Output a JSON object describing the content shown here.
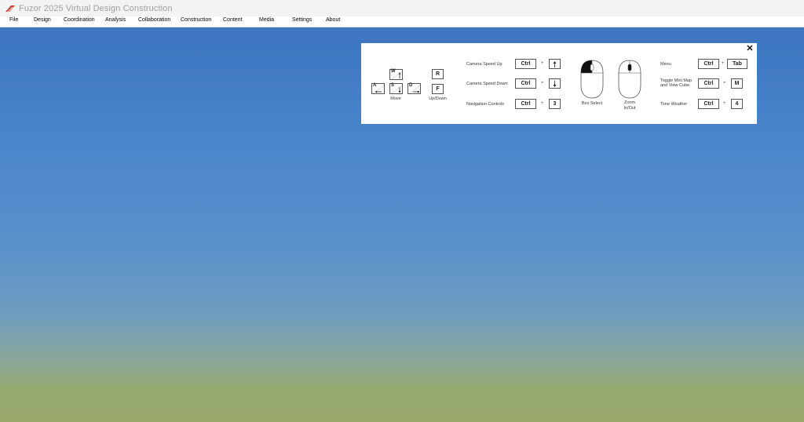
{
  "window": {
    "title": "Fuzor 2025 Virtual Design Construction",
    "logo_icon": "fuzor-logo-icon"
  },
  "menu": {
    "items": [
      "File",
      "Design",
      "Coordination",
      "Analysis",
      "Collaboration",
      "Construction",
      "Content",
      "Media",
      "Settings",
      "About"
    ]
  },
  "controls_panel": {
    "close_label": "✕",
    "movement": {
      "keys": {
        "w": "W",
        "a": "A",
        "s": "S",
        "d": "D",
        "r": "R",
        "f": "F"
      },
      "move_label": "Move",
      "updown_label": "Up/Down"
    },
    "camera": [
      {
        "label": "Camera Speed Up",
        "modifier": "Ctrl",
        "plus": "+",
        "key_icon": "arrow-up-icon"
      },
      {
        "label": "Camera Speed Down",
        "modifier": "Ctrl",
        "plus": "+",
        "key_icon": "arrow-down-icon"
      },
      {
        "label": "Navigation Controls",
        "modifier": "Ctrl",
        "plus": "+",
        "key": "3"
      }
    ],
    "mouse": {
      "box_select_label": "Box Select",
      "zoom_label_1": "Zoom",
      "zoom_label_2": "In/Out"
    },
    "shortcuts": [
      {
        "label": "Menu",
        "modifier": "Ctrl",
        "plus": "+",
        "key": "Tab"
      },
      {
        "label_1": "Toggle Mini Map",
        "label_2": "and View Cube",
        "modifier": "Ctrl",
        "plus": "+",
        "key": "M"
      },
      {
        "label": "Time Weather",
        "modifier": "Ctrl",
        "plus": "+",
        "key": "4"
      }
    ]
  },
  "colors": {
    "sky_top": "#3c74c0",
    "ground": "#9aa96c",
    "logo_red": "#c0392b"
  }
}
